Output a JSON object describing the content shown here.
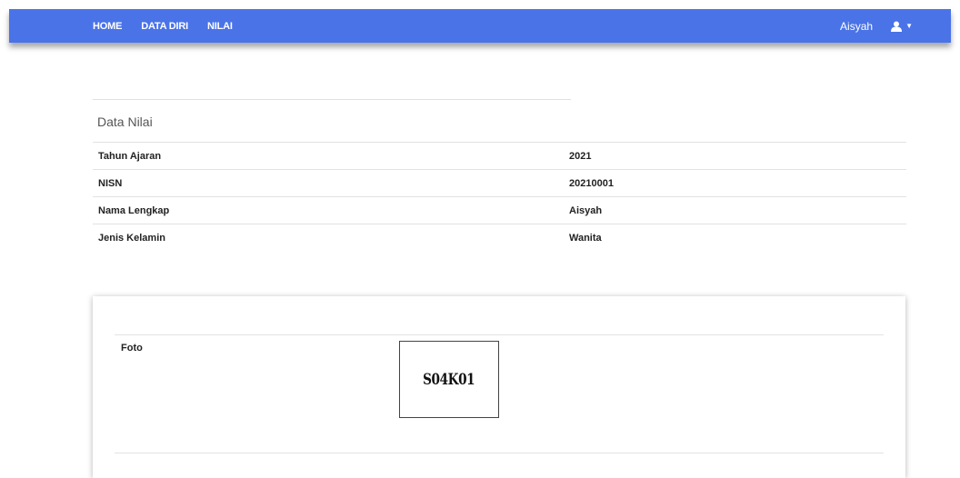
{
  "navbar": {
    "links": [
      "HOME",
      "DATA DIRI",
      "NILAI"
    ],
    "user_name": "Aisyah",
    "user_icon": "user-icon",
    "caret_icon": "caret-down-icon",
    "color": "#4a73e8"
  },
  "section": {
    "title": "Data Nilai"
  },
  "info_table": {
    "rows": [
      {
        "label": "Tahun Ajaran",
        "value": "2021"
      },
      {
        "label": "NISN",
        "value": "20210001"
      },
      {
        "label": "Nama Lengkap",
        "value": "Aisyah"
      },
      {
        "label": "Jenis Kelamin",
        "value": "Wanita"
      }
    ]
  },
  "photo_card": {
    "label": "Foto",
    "image_text": "S04K01"
  }
}
